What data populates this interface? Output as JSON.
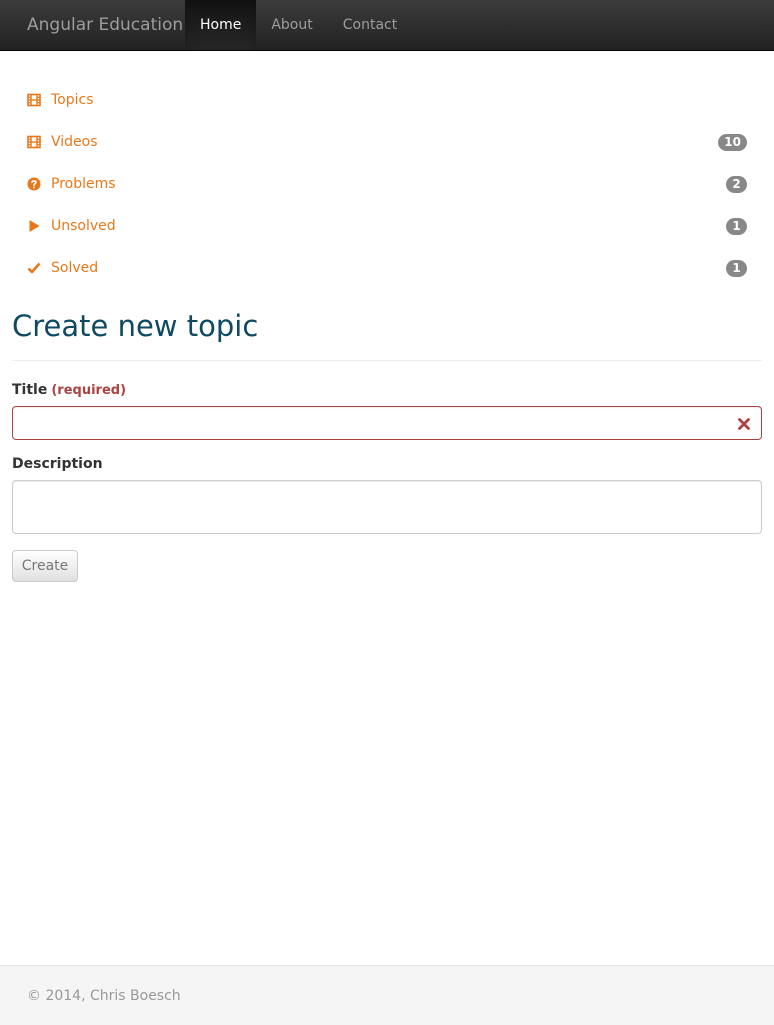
{
  "navbar": {
    "brand": "Angular Education",
    "items": [
      {
        "label": "Home",
        "active": true
      },
      {
        "label": "About",
        "active": false
      },
      {
        "label": "Contact",
        "active": false
      }
    ]
  },
  "menu": {
    "accent_color": "#e9781a",
    "badge_color": "#888888",
    "items": [
      {
        "label": "Topics",
        "icon": "film-icon",
        "badge": null
      },
      {
        "label": "Videos",
        "icon": "film-icon",
        "badge": "10"
      },
      {
        "label": "Problems",
        "icon": "question-circle-icon",
        "badge": "2"
      },
      {
        "label": "Unsolved",
        "icon": "play-icon",
        "badge": "1"
      },
      {
        "label": "Solved",
        "icon": "checkmark-icon",
        "badge": "1"
      }
    ]
  },
  "form": {
    "heading": "Create new topic",
    "title_label": "Title",
    "title_required": "(required)",
    "title_value": "",
    "title_error_icon": "remove-icon",
    "description_label": "Description",
    "description_value": "",
    "submit_label": "Create",
    "heading_color": "#0f4a62",
    "error_color": "#a94442"
  },
  "footer": {
    "text": "© 2014, Chris Boesch"
  }
}
